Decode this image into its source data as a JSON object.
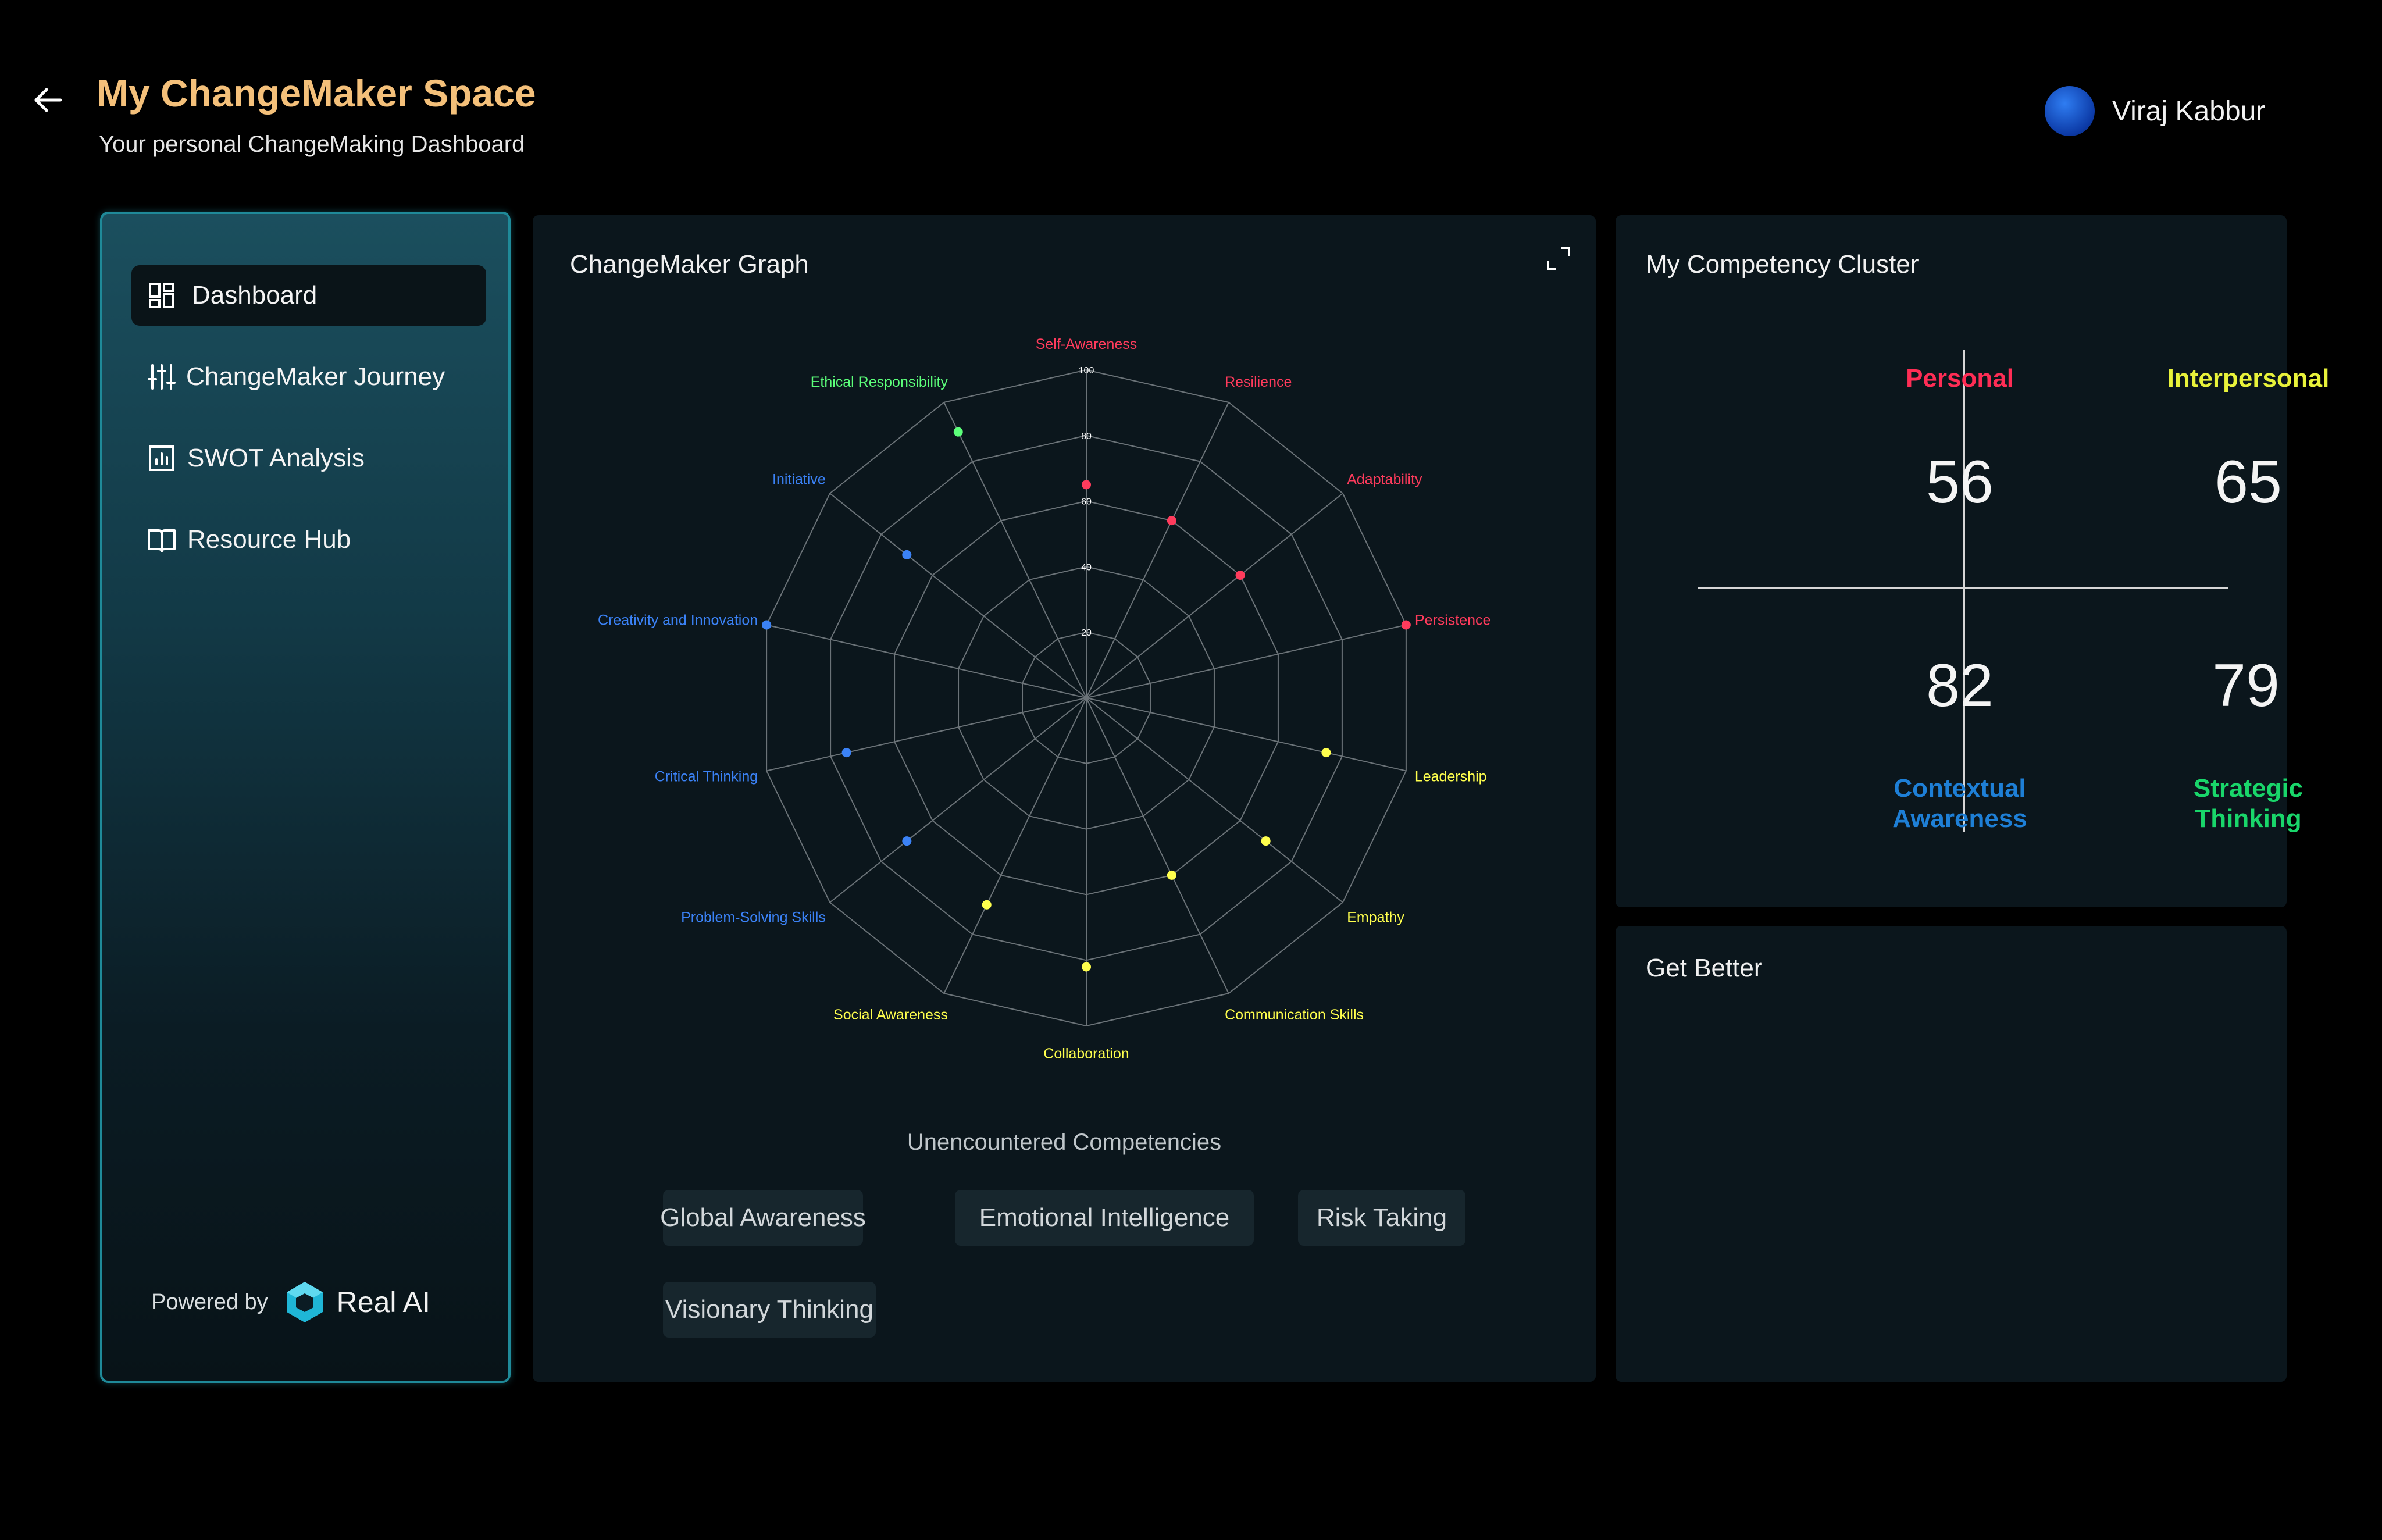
{
  "header": {
    "title": "My ChangeMaker Space",
    "subtitle": "Your personal ChangeMaking Dashboard"
  },
  "user": {
    "name": "Viraj Kabbur"
  },
  "sidebar": {
    "items": [
      {
        "label": "Dashboard",
        "icon": "dashboard-icon",
        "active": true
      },
      {
        "label": "ChangeMaker Journey",
        "icon": "sliders-icon",
        "active": false
      },
      {
        "label": "SWOT Analysis",
        "icon": "bar-chart-icon",
        "active": false
      },
      {
        "label": "Resource Hub",
        "icon": "book-icon",
        "active": false
      }
    ],
    "powered_by": "Powered by",
    "brand": "Real AI"
  },
  "graph_card": {
    "title": "ChangeMaker Graph",
    "unencountered_title": "Unencountered Competencies",
    "unencountered": [
      "Global Awareness",
      "Emotional Intelligence",
      "Risk Taking",
      "Visionary Thinking"
    ]
  },
  "chart_data": {
    "type": "radar",
    "categories": [
      "Self-Awareness",
      "Resilience",
      "Adaptability",
      "Persistence",
      "Leadership",
      "Empathy",
      "Communication Skills",
      "Collaboration",
      "Social Awareness",
      "Problem-Solving Skills",
      "Critical Thinking",
      "Creativity and Innovation",
      "Initiative",
      "Ethical Responsibility"
    ],
    "values": [
      65,
      60,
      60,
      100,
      75,
      70,
      60,
      82,
      70,
      70,
      75,
      100,
      70,
      90
    ],
    "category_colors": [
      "#ff3b5c",
      "#ff3b5c",
      "#ff3b5c",
      "#ff3b5c",
      "#ffff4d",
      "#ffff4d",
      "#ffff4d",
      "#ffff4d",
      "#ffff4d",
      "#3b82f6",
      "#3b82f6",
      "#3b82f6",
      "#3b82f6",
      "#5cff7a"
    ],
    "ticks": [
      "20",
      "40",
      "60",
      "80",
      "100"
    ],
    "rlim": [
      0,
      100
    ]
  },
  "cluster": {
    "title": "My Competency Cluster",
    "quadrants": [
      {
        "label": "Personal",
        "value": "56",
        "color": "#ff2d55"
      },
      {
        "label": "Interpersonal",
        "value": "65",
        "color": "#e8f23a"
      },
      {
        "label": "Contextual Awareness",
        "value": "82",
        "color": "#1e7fd6"
      },
      {
        "label": "Strategic Thinking",
        "value": "79",
        "color": "#19d66a"
      }
    ]
  },
  "get_better": {
    "title": "Get Better"
  }
}
